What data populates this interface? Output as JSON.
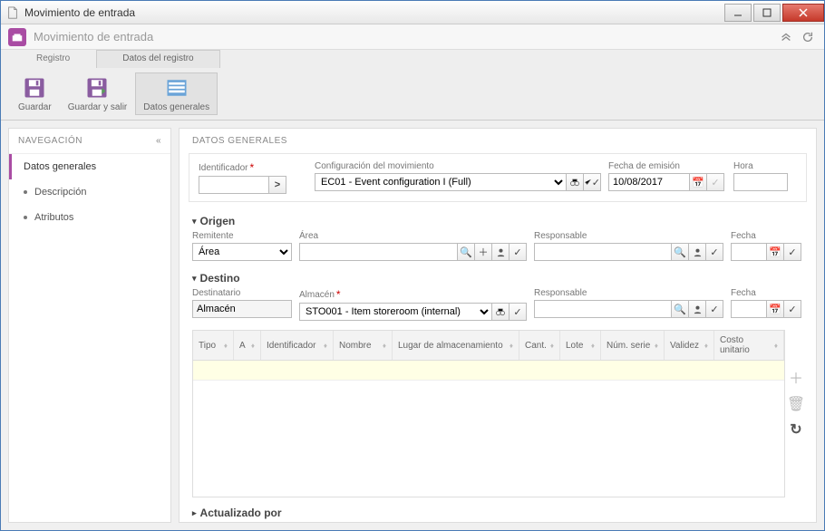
{
  "window": {
    "title": "Movimiento de entrada"
  },
  "header": {
    "subtitle": "Movimiento de entrada"
  },
  "ribbon_tabs": {
    "registro": "Registro",
    "datos_registro": "Datos del registro"
  },
  "ribbon": {
    "guardar": "Guardar",
    "guardar_salir": "Guardar y salir",
    "datos_generales": "Datos generales"
  },
  "nav": {
    "title": "NAVEGACIÓN",
    "items": [
      {
        "label": "Datos generales",
        "active": true
      },
      {
        "label": "Descripción",
        "active": false
      },
      {
        "label": "Atributos",
        "active": false
      }
    ]
  },
  "main": {
    "title": "DATOS GENERALES",
    "identificador": {
      "label": "Identificador",
      "value": ""
    },
    "config": {
      "label": "Configuración del movimiento",
      "value": "EC01 - Event configuration I (Full)"
    },
    "fecha_emision": {
      "label": "Fecha de emisión",
      "value": "10/08/2017"
    },
    "hora": {
      "label": "Hora",
      "value": ""
    },
    "seccion_origen": "Origen",
    "origen": {
      "remitente": {
        "label": "Remitente",
        "value": "Área"
      },
      "area": {
        "label": "Área",
        "value": ""
      },
      "responsable": {
        "label": "Responsable",
        "value": ""
      },
      "fecha": {
        "label": "Fecha",
        "value": ""
      }
    },
    "seccion_destino": "Destino",
    "destino": {
      "destinatario": {
        "label": "Destinatario",
        "value": "Almacén"
      },
      "almacen": {
        "label": "Almacén",
        "value": "STO001 - Item storeroom (internal)"
      },
      "responsable": {
        "label": "Responsable",
        "value": ""
      },
      "fecha": {
        "label": "Fecha",
        "value": ""
      }
    },
    "columns": {
      "tipo": "Tipo",
      "a": "A",
      "id": "Identificador",
      "nombre": "Nombre",
      "lugar": "Lugar de almacenamiento",
      "cant": "Cant.",
      "lote": "Lote",
      "numserie": "Núm. serie",
      "validez": "Validez",
      "costo": "Costo unitario"
    },
    "actualizado_por": "Actualizado por"
  }
}
